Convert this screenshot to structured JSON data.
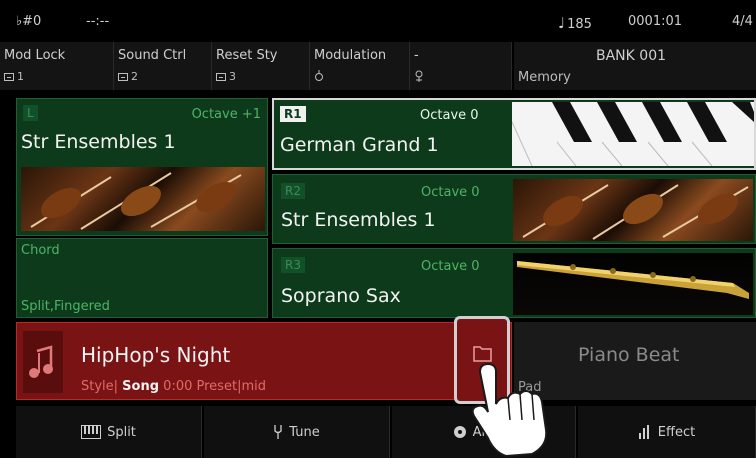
{
  "status": {
    "key": "♭#0",
    "time": "--:--",
    "tempo": "185",
    "bar": "0001:01",
    "beat": "4/4"
  },
  "controls": [
    {
      "label": "Mod Lock",
      "sub": "1",
      "icon": "box-icon"
    },
    {
      "label": "Sound Ctrl",
      "sub": "2",
      "icon": "box-icon"
    },
    {
      "label": "Reset Sty",
      "sub": "3",
      "icon": "box-icon"
    },
    {
      "label": "Modulation",
      "sub": "",
      "icon": "knob-icon"
    },
    {
      "label": "-",
      "sub": "",
      "icon": "pin-icon"
    }
  ],
  "bank": {
    "name": "BANK 001",
    "memory_label": "Memory"
  },
  "voices": {
    "left": {
      "tag": "L",
      "octave": "Octave +1",
      "name": "Str Ensembles 1",
      "image": "strings"
    },
    "r1": {
      "tag": "R1",
      "octave": "Octave 0",
      "name": "German Grand 1",
      "image": "piano"
    },
    "r2": {
      "tag": "R2",
      "octave": "Octave 0",
      "name": "Str Ensembles 1",
      "image": "strings"
    },
    "r3": {
      "tag": "R3",
      "octave": "Octave 0",
      "name": "Soprano Sax",
      "image": "sax"
    }
  },
  "chord": {
    "title": "Chord",
    "mode": "Split,Fingered"
  },
  "style": {
    "name": "HipHop's Night",
    "type_label": "Style",
    "song_label": "Song",
    "song_time": "0:00",
    "preset_label": "Preset",
    "preset_value": "mid"
  },
  "pad": {
    "name": "Piano Beat",
    "label": "Pad"
  },
  "bottom": [
    {
      "label": "Split",
      "icon": "keyboard-icon"
    },
    {
      "label": "Tune",
      "icon": "tuning-fork-icon"
    },
    {
      "label": "Album",
      "icon": "disc-icon"
    },
    {
      "label": "Effect",
      "icon": "equalizer-icon"
    }
  ],
  "colors": {
    "voice_green": "#0d3a1b",
    "style_red": "#7a1414",
    "accent_green": "#4fb368"
  }
}
